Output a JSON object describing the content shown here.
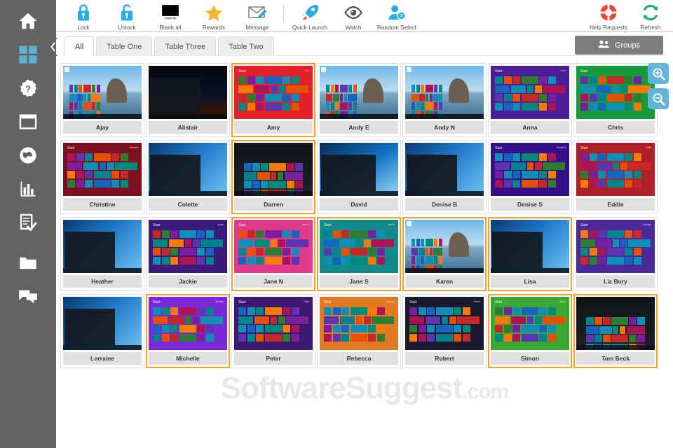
{
  "sidebar": {
    "items": [
      {
        "name": "home",
        "icon": "home-icon",
        "active": false
      },
      {
        "name": "dashboard",
        "icon": "grid-icon",
        "active": true
      },
      {
        "name": "help",
        "icon": "question-icon",
        "active": false
      },
      {
        "name": "windows",
        "icon": "window-icon",
        "active": false
      },
      {
        "name": "internet",
        "icon": "globe-icon",
        "active": false
      },
      {
        "name": "reports",
        "icon": "bar-chart-icon",
        "active": false
      },
      {
        "name": "tests",
        "icon": "checklist-icon",
        "active": false
      },
      {
        "name": "files",
        "icon": "folder-icon",
        "active": false
      },
      {
        "name": "chat",
        "icon": "chat-icon",
        "active": false
      }
    ],
    "collapse_icon": "chevron-left-icon"
  },
  "toolbar": {
    "left_buttons": [
      {
        "label": "Lock",
        "icon": "lock-closed-icon"
      },
      {
        "label": "Unlock",
        "icon": "lock-open-icon"
      },
      {
        "label": "Blank all",
        "icon": "monitor-icon"
      },
      {
        "label": "Rewards",
        "icon": "star-icon"
      },
      {
        "label": "Message",
        "icon": "envelope-pencil-icon"
      }
    ],
    "right_of_separator": [
      {
        "label": "Quick Launch",
        "icon": "rocket-icon"
      },
      {
        "label": "Watch",
        "icon": "eye-icon"
      },
      {
        "label": "Random Select",
        "icon": "user-question-icon"
      }
    ],
    "far_right_buttons": [
      {
        "label": "Help Requests",
        "icon": "life-ring-icon"
      },
      {
        "label": "Refresh",
        "icon": "refresh-icon"
      }
    ]
  },
  "tabbar": {
    "tabs": [
      {
        "label": "All",
        "active": true
      },
      {
        "label": "Table One",
        "active": false
      },
      {
        "label": "Table Three",
        "active": false
      },
      {
        "label": "Table Two",
        "active": false
      }
    ],
    "groups_button": {
      "label": "Groups",
      "icon": "users-icon"
    }
  },
  "grid": {
    "zoom_in_label": "+",
    "zoom_out_label": "−",
    "zoom_in_icon": "magnifier-plus-icon",
    "zoom_out_icon": "magnifier-minus-icon",
    "stations": [
      {
        "name": "Ajay",
        "style": "w10-desktop-beach",
        "selected": false,
        "accent": "#f0a81e"
      },
      {
        "name": "Alistair",
        "style": "w10-startmenu-night",
        "selected": false,
        "accent": "#2b7fd4"
      },
      {
        "name": "Amy",
        "style": "w8-start-red",
        "selected": true,
        "accent": "#e4202a"
      },
      {
        "name": "Andy E",
        "style": "w10-desktop-beach",
        "selected": false,
        "accent": "#f0a81e"
      },
      {
        "name": "Andy N",
        "style": "w10-desktop-beach",
        "selected": false,
        "accent": "#2b7fd4"
      },
      {
        "name": "Anna",
        "style": "w8-start-purple",
        "selected": false,
        "accent": "#4b1e96"
      },
      {
        "name": "Chris",
        "style": "w8-start-green",
        "selected": false,
        "accent": "#179c3c"
      },
      {
        "name": "Christine",
        "style": "w8-start-maroon",
        "selected": false,
        "accent": "#7c1020"
      },
      {
        "name": "Colette",
        "style": "w10-startmenu-blue",
        "selected": false,
        "accent": "#2b7fd4"
      },
      {
        "name": "Darren",
        "style": "w10-dark-cards",
        "selected": true,
        "accent": "#22262b"
      },
      {
        "name": "David",
        "style": "w10-desktop-hero",
        "selected": false,
        "accent": "#1d7fd0"
      },
      {
        "name": "Denise B",
        "style": "w10-startmenu-blue",
        "selected": false,
        "accent": "#123a6e"
      },
      {
        "name": "Denise S",
        "style": "w8-start-purple",
        "selected": false,
        "accent": "#36108a"
      },
      {
        "name": "Eddie",
        "style": "w8-start-red",
        "selected": false,
        "accent": "#b01f25"
      },
      {
        "name": "Heather",
        "style": "w10-startmenu-blue",
        "selected": false,
        "accent": "#1d7fd0"
      },
      {
        "name": "Jackie",
        "style": "w8-start-purple",
        "selected": false,
        "accent": "#3b1a7a"
      },
      {
        "name": "Jane N",
        "style": "w8-start-pink",
        "selected": true,
        "accent": "#e03a8e"
      },
      {
        "name": "Jane S",
        "style": "w8-start-teal",
        "selected": true,
        "accent": "#128a8a"
      },
      {
        "name": "Karen",
        "style": "w10-desktop-beach",
        "selected": true,
        "accent": "#f0a81e"
      },
      {
        "name": "Lisa",
        "style": "w10-startmenu-blue",
        "selected": true,
        "accent": "#1d7fd0"
      },
      {
        "name": "Liz Bury",
        "style": "w8-start-purple",
        "selected": false,
        "accent": "#4b2b9c"
      },
      {
        "name": "Lorraine",
        "style": "w10-startmenu-blue",
        "selected": false,
        "accent": "#1d7fd0"
      },
      {
        "name": "Michelle",
        "style": "w8-start-violet",
        "selected": true,
        "accent": "#7b28d8"
      },
      {
        "name": "Peter",
        "style": "w8-start-purple",
        "selected": false,
        "accent": "#3c1a72"
      },
      {
        "name": "Rebecca",
        "style": "w8-start-orange",
        "selected": false,
        "accent": "#e07a22"
      },
      {
        "name": "Robert",
        "style": "w8-start-dark",
        "selected": false,
        "accent": "#1a1a2e"
      },
      {
        "name": "Simon",
        "style": "w8-start-green",
        "selected": true,
        "accent": "#3aa832"
      },
      {
        "name": "Tom Beck",
        "style": "w10-dark-cards",
        "selected": true,
        "accent": "#22262b"
      }
    ]
  },
  "watermark": {
    "brand": "SoftwareSuggest",
    "tld": ".com"
  }
}
